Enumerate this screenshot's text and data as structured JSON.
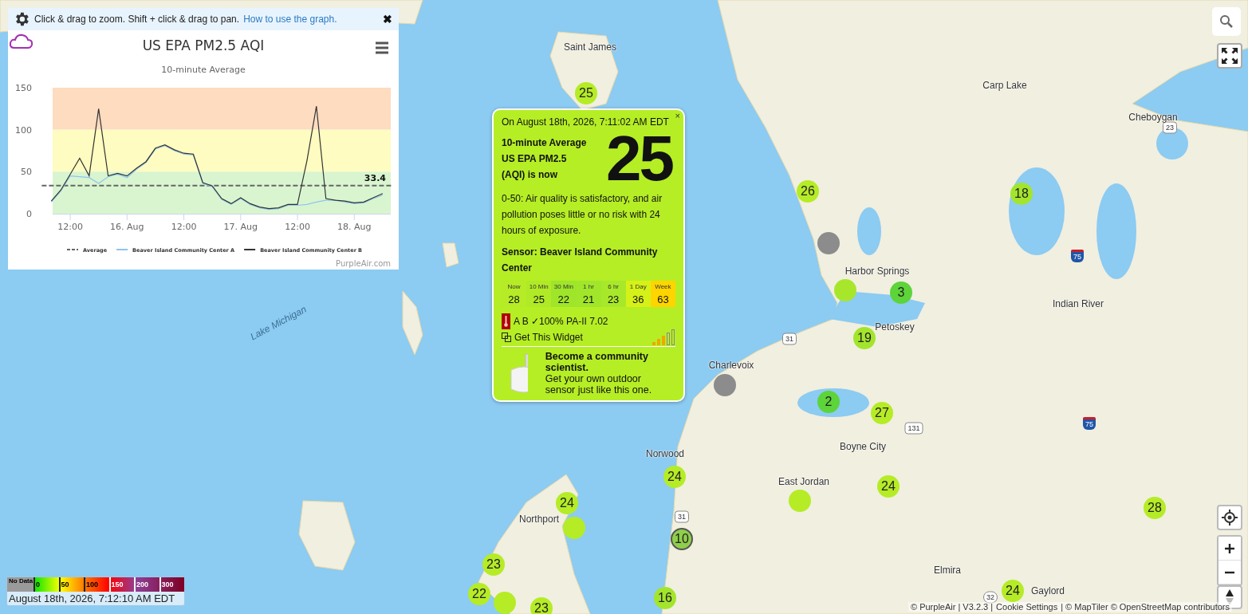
{
  "chart_panel": {
    "hint": {
      "text": "Click & drag to zoom. Shift + click & drag to pan.",
      "link": "How to use the graph.",
      "close": "✖"
    },
    "subtitle": "10-minute Average",
    "credit": "PurpleAir.com",
    "chart_data": {
      "type": "line",
      "title": "US EPA PM2.5 AQI",
      "ylim": [
        0,
        150
      ],
      "yticks": [
        0,
        50,
        100,
        150
      ],
      "categories": [
        null,
        null,
        null,
        "12:00",
        null,
        null,
        null,
        null,
        null,
        "16. Aug",
        null,
        null,
        null,
        null,
        null,
        "12:00",
        null,
        null,
        null,
        null,
        null,
        "17. Aug",
        null,
        null,
        null,
        null,
        null,
        "12:00",
        null,
        null,
        null,
        null,
        null,
        "18. Aug",
        null,
        null,
        null,
        null
      ],
      "series": [
        {
          "name": "Average",
          "color": "#666666",
          "line_style": "dashed",
          "values": [
            33.4,
            33.4,
            33.4,
            33.4,
            33.4,
            33.4,
            33.4,
            33.4,
            33.4,
            33.4,
            33.4,
            33.4,
            33.4,
            33.4,
            33.4,
            33.4,
            33.4,
            33.4,
            33.4,
            33.4,
            33.4,
            33.4,
            33.4,
            33.4,
            33.4,
            33.4,
            33.4,
            33.4,
            33.4,
            33.4,
            33.4,
            33.4,
            33.4,
            33.4,
            33.4,
            33.4,
            33.4,
            33.4
          ]
        },
        {
          "name": "Beaver Island Community Center A",
          "color": "#8ec4f0",
          "line_style": "solid",
          "values": [
            null,
            14,
            27,
            45,
            44,
            43,
            36,
            44,
            47,
            43,
            53,
            61,
            77,
            81,
            75,
            71,
            70,
            36,
            32,
            17,
            11,
            18,
            11,
            7,
            5,
            6,
            10,
            10,
            11,
            14,
            16,
            16,
            14,
            12,
            13,
            18,
            22,
            null
          ]
        },
        {
          "name": "Beaver Island Community Center B",
          "color": "#333333",
          "line_style": "solid",
          "values": [
            null,
            15,
            28,
            47,
            66,
            45,
            125,
            45,
            48,
            45,
            54,
            62,
            78,
            82,
            76,
            72,
            71,
            37,
            33,
            18,
            12,
            19,
            12,
            8,
            6,
            7,
            11,
            11,
            63,
            128,
            18,
            16,
            15,
            13,
            14,
            19,
            24,
            null
          ]
        }
      ],
      "bands": [
        {
          "axis": "y",
          "from": 100,
          "to": 150,
          "color": "#fddcc0"
        },
        {
          "axis": "y",
          "from": 50,
          "to": 100,
          "color": "#fefcc0"
        },
        {
          "axis": "y",
          "from": 0,
          "to": 50,
          "color": "#d9f5cf"
        }
      ],
      "legend": true,
      "annotations": [
        {
          "y": 33.4,
          "text": "33.4"
        }
      ]
    }
  },
  "places": [
    "Saint James",
    "Carp Lake",
    "Cheboygan",
    "Harbor Springs",
    "Indian River",
    "Petoskey",
    "Charlevoix",
    "Boyne City",
    "Norwood",
    "East Jordan",
    "Northport",
    "Elmira",
    "Gaylord",
    "Lake Michigan"
  ],
  "routes": [
    {
      "number": "23",
      "kind": "us"
    },
    {
      "number": "75",
      "kind": "interstate"
    },
    {
      "number": "31",
      "kind": "us"
    },
    {
      "number": "31",
      "kind": "us"
    },
    {
      "number": "131",
      "kind": "us"
    },
    {
      "number": "75",
      "kind": "interstate"
    },
    {
      "number": "32",
      "kind": "state"
    }
  ],
  "markers": [
    {
      "label": "25",
      "color": "#b5ec26",
      "kind": "plain"
    },
    {
      "label": "26",
      "color": "#b5ec26",
      "kind": "plain"
    },
    {
      "label": "18",
      "color": "#a3e52c",
      "kind": "plain"
    },
    {
      "color": "#8c8c8c",
      "kind": "plain"
    },
    {
      "color": "#a8e62b",
      "kind": "plain"
    },
    {
      "label": "3",
      "color": "#5dd43a",
      "kind": "plain"
    },
    {
      "label": "19",
      "color": "#a3e52c",
      "kind": "plain"
    },
    {
      "color": "#8c8c8c",
      "kind": "plain"
    },
    {
      "label": "2",
      "color": "#5dd43a",
      "kind": "plain"
    },
    {
      "label": "27",
      "color": "#b5ec26",
      "kind": "plain"
    },
    {
      "label": "24",
      "color": "#b5ec26",
      "kind": "plain"
    },
    {
      "label": "24",
      "color": "#b5ec26",
      "kind": "plain"
    },
    {
      "color": "#b5ec26",
      "kind": "plain"
    },
    {
      "label": "24",
      "color": "#b5ec26",
      "kind": "plain"
    },
    {
      "color": "#b5ec26",
      "kind": "plain"
    },
    {
      "label": "28",
      "color": "#b5ec26",
      "kind": "plain"
    },
    {
      "label": "10",
      "color": "#8fcf4a",
      "kind": "outlined"
    },
    {
      "label": "23",
      "color": "#b5ec26",
      "kind": "plain"
    },
    {
      "label": "22",
      "color": "#b5ec26",
      "kind": "plain"
    },
    {
      "color": "#b5ec26",
      "kind": "plain"
    },
    {
      "label": "16",
      "color": "#a3e52c",
      "kind": "plain"
    },
    {
      "label": "24",
      "color": "#b5ec26",
      "kind": "plain"
    },
    {
      "label": "23",
      "color": "#b5ec26",
      "kind": "plain"
    }
  ],
  "popup": {
    "close": "×",
    "timestamp": "On August 18th, 2026, 7:11:02 AM EDT",
    "heading": [
      "10-minute Average",
      "US EPA PM2.5",
      "(AQI) is now"
    ],
    "value": "25",
    "description": "0-50: Air quality is satisfactory, and air pollution poses little or no risk with 24 hours of exposure.",
    "sensor": "Sensor: Beaver Island Community Center",
    "averages": [
      {
        "label": "Now",
        "value": "28",
        "color": "#b5ec26"
      },
      {
        "label": "10 Min",
        "value": "25",
        "color": "#b0ea27"
      },
      {
        "label": "30 Min",
        "value": "22",
        "color": "#9fe52a"
      },
      {
        "label": "1 hr",
        "value": "21",
        "color": "#a1e62b"
      },
      {
        "label": "6 hr",
        "value": "23",
        "color": "#a8e82a"
      },
      {
        "label": "1 Day",
        "value": "36",
        "color": "#d6f117"
      },
      {
        "label": "Week",
        "value": "63",
        "color": "#ffd500"
      }
    ],
    "status": "A B ✓100% PA-II 7.02",
    "widget_link": "Get This Widget",
    "promo_title": "Become a community scientist.",
    "promo_text": "Get your own outdoor sensor just like this one."
  },
  "legend": {
    "no_data": "No Data",
    "steps": [
      "0",
      "50",
      "100",
      "150",
      "200",
      "300"
    ],
    "timestamp": "August 18th, 2026, 7:12:10 AM EDT"
  },
  "attribution": {
    "before": "© PurpleAir | V3.2.3 |",
    "cookie_link": "Cookie Settings",
    "after": "| © MapTiler © OpenStreetMap contributors"
  }
}
